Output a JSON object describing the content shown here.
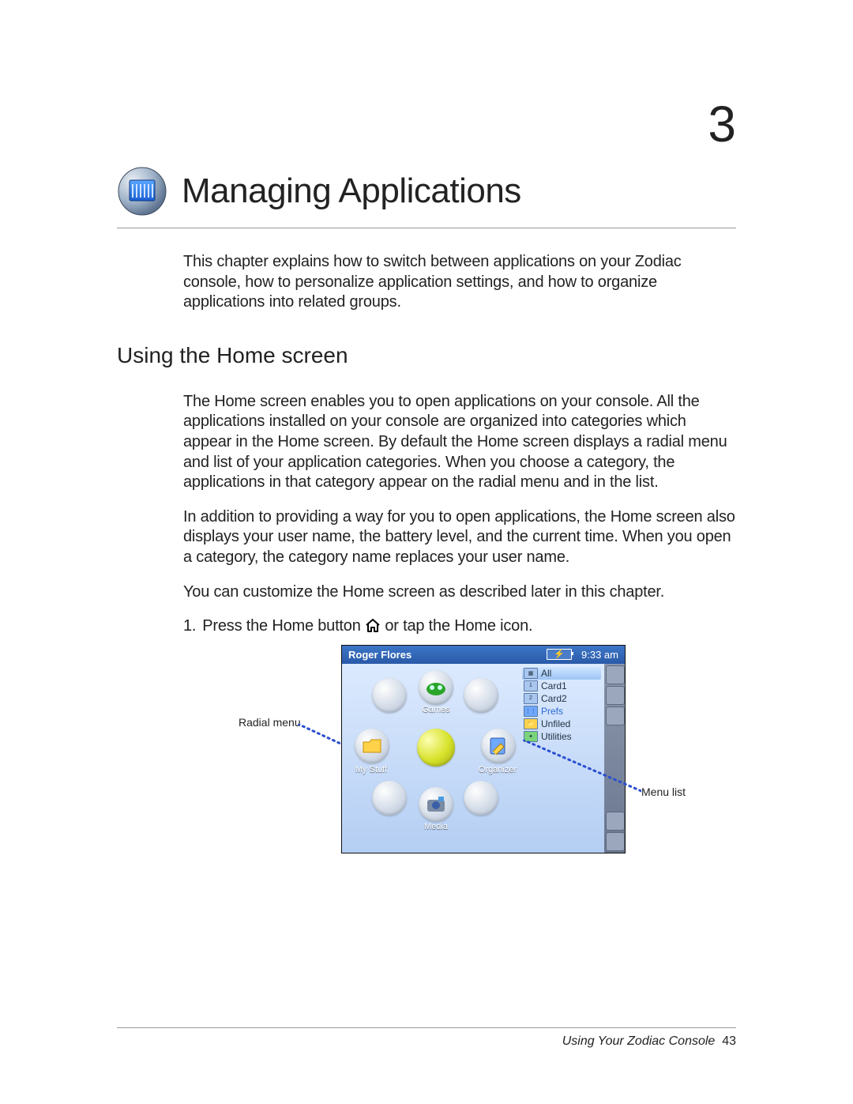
{
  "chapter": {
    "number": "3",
    "title": "Managing Applications"
  },
  "intro": "This chapter explains how to switch between applications on your Zodiac console, how to personalize application settings, and how to organize applications into related groups.",
  "section1": {
    "heading": "Using the Home screen"
  },
  "para1": "The Home screen enables you to open applications on your console. All the applications installed on your console are organized into categories which appear in the Home screen. By default the Home screen displays a radial menu and list of your application categories. When you choose a category, the applications in that category appear on the radial menu and in the list.",
  "para2": "In addition to providing a way for you to open applications, the Home screen also displays your user name, the battery level, and the current time. When you open a category, the category name replaces your user name.",
  "para3": "You can customize the Home screen as described later in this chapter.",
  "step1": {
    "num": "1.",
    "before": "Press the Home button ",
    "after": " or tap the Home icon."
  },
  "screenshot": {
    "user": "Roger Flores",
    "time": "9:33 am",
    "radial": {
      "top": "Games",
      "left": "My Stuff",
      "right": "Organizer",
      "bottom": "Media"
    },
    "list": [
      "All",
      "Card1",
      "Card2",
      "Prefs",
      "Unfiled",
      "Utilities"
    ]
  },
  "figlabels": {
    "left": "Radial menu",
    "right": "Menu list"
  },
  "footer": {
    "book": "Using Your Zodiac Console",
    "page": "43"
  }
}
